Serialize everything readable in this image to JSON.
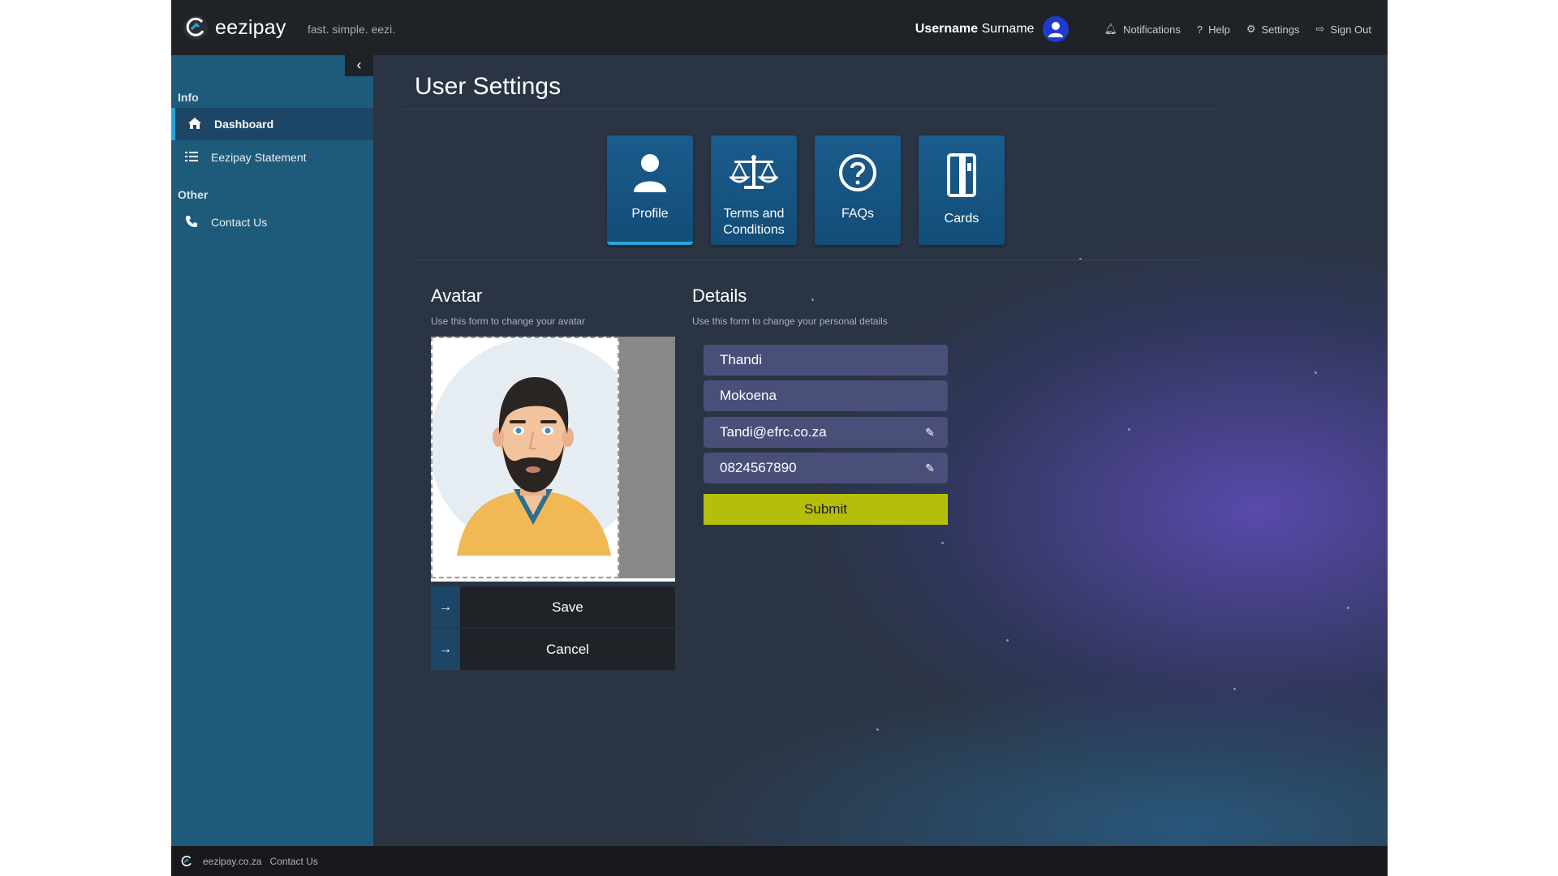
{
  "header": {
    "brand": "eezipay",
    "tagline": "fast. simple. eezi.",
    "username_bold": "Username",
    "username_rest": "Surname",
    "nav": [
      {
        "label": "Notifications",
        "icon": "bell-icon"
      },
      {
        "label": "Help",
        "icon": "question-icon"
      },
      {
        "label": "Settings",
        "icon": "gear-icon"
      },
      {
        "label": "Sign Out",
        "icon": "sign-out-icon"
      }
    ]
  },
  "sidebar": {
    "sections": [
      {
        "heading": "Info",
        "items": [
          {
            "label": "Dashboard",
            "icon": "home-icon",
            "active": true
          },
          {
            "label": "Eezipay Statement",
            "icon": "list-icon",
            "active": false
          }
        ]
      },
      {
        "heading": "Other",
        "items": [
          {
            "label": "Contact Us",
            "icon": "phone-icon",
            "active": false
          }
        ]
      }
    ]
  },
  "main": {
    "title": "User Settings",
    "tiles": [
      {
        "label": "Profile",
        "icon": "user-icon"
      },
      {
        "label": "Terms and Conditions",
        "icon": "scales-icon"
      },
      {
        "label": "FAQs",
        "icon": "question-circle-icon"
      },
      {
        "label": "Cards",
        "icon": "card-icon"
      }
    ],
    "avatar": {
      "title": "Avatar",
      "subtitle": "Use this form to change your avatar",
      "save_label": "Save",
      "cancel_label": "Cancel"
    },
    "details": {
      "title": "Details",
      "subtitle": "Use this form to change your personal details",
      "first_name": "Thandi",
      "last_name": "Mokoena",
      "email": "Tandi@efrc.co.za",
      "phone": "0824567890",
      "submit_label": "Submit"
    }
  },
  "footer": {
    "site": "eezipay.co.za",
    "contact": "Contact Us"
  },
  "colors": {
    "topbar": "#1f2227",
    "sidebar": "#1e5b7a",
    "tile": "#1a5c8d",
    "accent": "#2aa3d8",
    "submit": "#b5be0b",
    "field": "#4a4f7a"
  }
}
